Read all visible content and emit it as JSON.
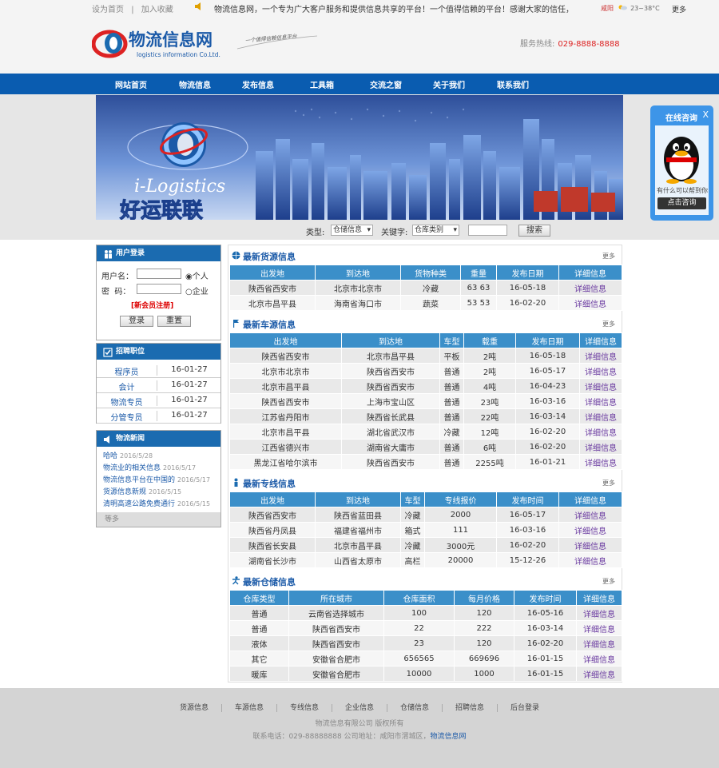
{
  "topbar": {
    "home": "设为首页",
    "sep": "|",
    "fav": "加入收藏",
    "marquee": "物流信息网，一个专为广大客户服务和提供信息共享的平台！一个值得信赖的平台！感谢大家的信任，被信任",
    "weather_city": "咸阳",
    "weather_temp": "23~38°C",
    "more": "更多"
  },
  "logo": {
    "cn": "物流信息网",
    "en": "logistics information Co.Ltd.",
    "slogan": "一个值得信赖信息平台"
  },
  "hotline": {
    "label": "服务热线:",
    "number": "029-8888-8888"
  },
  "nav": [
    "网站首页",
    "物流信息",
    "发布信息",
    "工具箱",
    "交流之窗",
    "关于我们",
    "联系我们"
  ],
  "banner": {
    "en": "i-Logistics",
    "cn": "好运联联"
  },
  "search": {
    "type_label": "类型:",
    "type_value": "仓储信息",
    "kw_label": "关键字:",
    "kw_value": "仓库类别",
    "button": "搜索"
  },
  "qq": {
    "title": "在线咨询",
    "close": "X",
    "msg": "有什么可以帮到你",
    "button": "点击咨询"
  },
  "login": {
    "title": "用户登录",
    "user_label": "用户名：",
    "pwd_label": "密  码：",
    "r1": "个人",
    "r2": "企业",
    "register": "[新会员注册]",
    "login_btn": "登录",
    "reset_btn": "重置"
  },
  "jobs": {
    "title": "招聘职位",
    "rows": [
      [
        "程序员",
        "16-01-27"
      ],
      [
        "会计",
        "16-01-27"
      ],
      [
        "物流专员",
        "16-01-27"
      ],
      [
        "分管专员",
        "16-01-27"
      ]
    ]
  },
  "news": {
    "title": "物流新闻",
    "rows": [
      [
        "哈哈",
        "2016/5/28"
      ],
      [
        "物流业的相关信息",
        "2016/5/17"
      ],
      [
        "物流信息平台在中国的",
        "2016/5/17"
      ],
      [
        "货源信息新规",
        "2016/5/15"
      ],
      [
        "清明高速公路免费通行",
        "2016/5/15"
      ]
    ],
    "more": "等多"
  },
  "sections": {
    "goods": {
      "title": "最新货源信息",
      "more": "更多",
      "headers": [
        "出发地",
        "到达地",
        "货物种类",
        "重量",
        "发布日期",
        "详细信息"
      ],
      "rows": [
        [
          "陕西省西安市",
          "北京市北京市",
          "冷藏",
          "63 63",
          "16-05-18",
          "详细信息"
        ],
        [
          "北京市昌平县",
          "海南省海口市",
          "蔬菜",
          "53 53",
          "16-02-20",
          "详细信息"
        ]
      ]
    },
    "vehicles": {
      "title": "最新车源信息",
      "more": "更多",
      "headers": [
        "出发地",
        "到达地",
        "车型",
        "载重",
        "发布日期",
        "详细信息"
      ],
      "rows": [
        [
          "陕西省西安市",
          "北京市昌平县",
          "平板",
          "2吨",
          "16-05-18",
          "详细信息"
        ],
        [
          "北京市北京市",
          "陕西省西安市",
          "普通",
          "2吨",
          "16-05-17",
          "详细信息"
        ],
        [
          "北京市昌平县",
          "陕西省西安市",
          "普通",
          "4吨",
          "16-04-23",
          "详细信息"
        ],
        [
          "陕西省西安市",
          "上海市宝山区",
          "普通",
          "23吨",
          "16-03-16",
          "详细信息"
        ],
        [
          "江苏省丹阳市",
          "陕西省长武县",
          "普通",
          "22吨",
          "16-03-14",
          "详细信息"
        ],
        [
          "北京市昌平县",
          "湖北省武汉市",
          "冷藏",
          "12吨",
          "16-02-20",
          "详细信息"
        ],
        [
          "江西省德兴市",
          "湖南省大庸市",
          "普通",
          "6吨",
          "16-02-20",
          "详细信息"
        ],
        [
          "黑龙江省哈尔滨市",
          "陕西省西安市",
          "普通",
          "2255吨",
          "16-01-21",
          "详细信息"
        ]
      ]
    },
    "lines": {
      "title": "最新专线信息",
      "more": "更多",
      "headers": [
        "出发地",
        "到达地",
        "车型",
        "专线报价",
        "发布时间",
        "详细信息"
      ],
      "rows": [
        [
          "陕西省西安市",
          "陕西省蓝田县",
          "冷藏",
          "2000",
          "16-05-17",
          "详细信息"
        ],
        [
          "陕西省丹凤县",
          "福建省福州市",
          "箱式",
          "111",
          "16-03-16",
          "详细信息"
        ],
        [
          "陕西省长安县",
          "北京市昌平县",
          "冷藏",
          "3000元",
          "16-02-20",
          "详细信息"
        ],
        [
          "湖南省长沙市",
          "山西省太原市",
          "高栏",
          "20000",
          "15-12-26",
          "详细信息"
        ]
      ]
    },
    "storage": {
      "title": "最新仓储信息",
      "more": "更多",
      "headers": [
        "仓库类型",
        "所在城市",
        "仓库面积",
        "每月价格",
        "发布时间",
        "详细信息"
      ],
      "rows": [
        [
          "普通",
          "云南省选择城市",
          "100",
          "120",
          "16-05-16",
          "详细信息"
        ],
        [
          "普通",
          "陕西省西安市",
          "22",
          "222",
          "16-03-14",
          "详细信息"
        ],
        [
          "液体",
          "陕西省西安市",
          "23",
          "120",
          "16-02-20",
          "详细信息"
        ],
        [
          "其它",
          "安徽省合肥市",
          "656565",
          "669696",
          "16-01-15",
          "详细信息"
        ],
        [
          "暖库",
          "安徽省合肥市",
          "10000",
          "1000",
          "16-01-15",
          "详细信息"
        ]
      ]
    }
  },
  "footer": {
    "links": [
      "货源信息",
      "车源信息",
      "专线信息",
      "企业信息",
      "仓储信息",
      "招聘信息",
      "后台登录"
    ],
    "copy": "物流信息有限公司 版权所有",
    "contact": "联系电话：029-88888888 公司地址：咸阳市渭城区，",
    "contact_link": "物流信息网"
  }
}
